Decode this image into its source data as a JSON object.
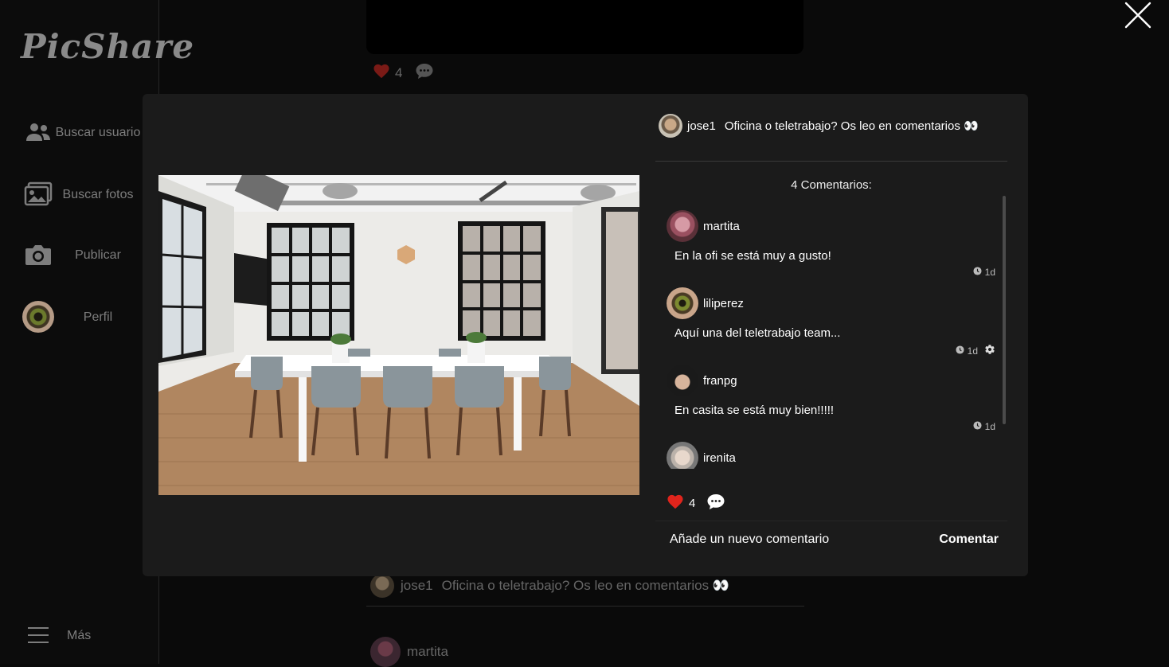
{
  "app": {
    "logo": "PicShare"
  },
  "sidebar": {
    "items": [
      {
        "label": "Buscar usuario",
        "icon": "users-icon"
      },
      {
        "label": "Buscar fotos",
        "icon": "images-icon"
      },
      {
        "label": "Publicar",
        "icon": "camera-icon"
      },
      {
        "label": "Perfil",
        "icon": "avatar"
      }
    ],
    "more_label": "Más"
  },
  "background": {
    "likes": "4",
    "post_user": "jose1",
    "post_caption": "Oficina o teletrabajo? Os leo en comentarios 👀",
    "comment_user": "martita"
  },
  "modal": {
    "post": {
      "user": "jose1",
      "caption": "Oficina o teletrabajo? Os leo en comentarios 👀"
    },
    "comments_count_label": "4 Comentarios:",
    "comments": [
      {
        "user": "martita",
        "text": "En la ofi se está muy a gusto!",
        "time": "1d",
        "owner": false
      },
      {
        "user": "liliperez",
        "text": "Aquí una del teletrabajo team...",
        "time": "1d",
        "owner": true
      },
      {
        "user": "franpg",
        "text": "En casita se está muy bien!!!!!",
        "time": "1d",
        "owner": false
      },
      {
        "user": "irenita",
        "text": "",
        "time": "",
        "owner": false
      }
    ],
    "likes": "4",
    "add_comment_placeholder": "Añade un nuevo comentario",
    "submit_label": "Comentar"
  },
  "colors": {
    "like": "#e0241c",
    "background": "#0a0a0a",
    "modal": "#1b1b1b"
  }
}
